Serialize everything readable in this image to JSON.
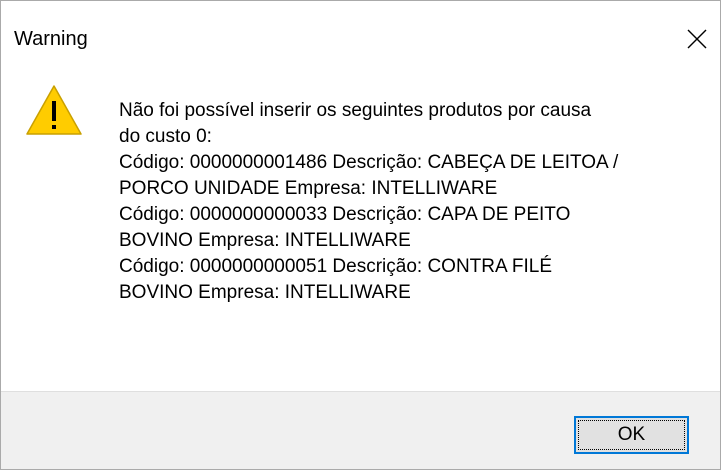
{
  "window": {
    "title": "Warning",
    "close_icon": "close-icon"
  },
  "message": {
    "icon": "warning-icon",
    "lines": [
      "Não foi possível inserir os seguintes produtos por causa",
      "do custo 0:",
      "Código: 0000000001486 Descrição: CABEÇA DE LEITOA /",
      "PORCO UNIDADE Empresa: INTELLIWARE",
      "Código: 0000000000033 Descrição: CAPA DE PEITO",
      "BOVINO Empresa: INTELLIWARE",
      "Código: 0000000000051 Descrição: CONTRA FILÉ",
      "BOVINO Empresa: INTELLIWARE"
    ]
  },
  "buttons": {
    "ok_label": "OK"
  },
  "colors": {
    "accent": "#0078d7",
    "warning_fill": "#ffcc00",
    "footer_bg": "#f0f0f0"
  }
}
